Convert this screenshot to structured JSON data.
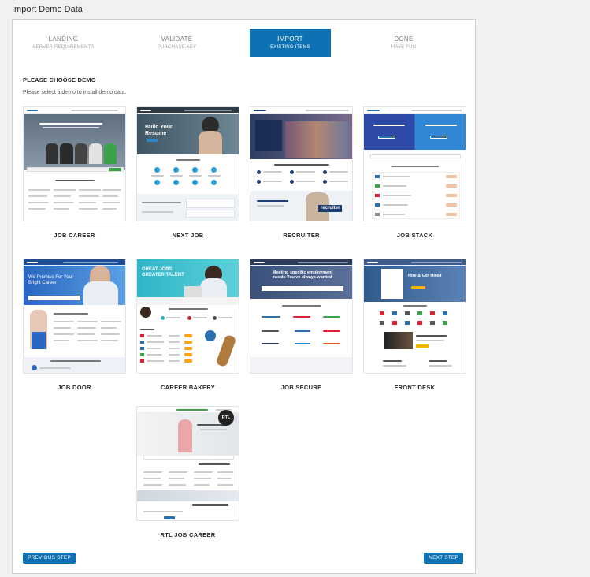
{
  "page": {
    "title": "Import Demo Data"
  },
  "steps": [
    {
      "title": "LANDING",
      "subtitle": "SERVER REQUIREMENTS",
      "active": false
    },
    {
      "title": "VALIDATE",
      "subtitle": "PURCHASE KEY",
      "active": false
    },
    {
      "title": "IMPORT",
      "subtitle": "EXISTING ITEMS",
      "active": true
    },
    {
      "title": "DONE",
      "subtitle": "HAVE FUN",
      "active": false
    }
  ],
  "section": {
    "heading": "PLEASE CHOOSE DEMO",
    "instruction": "Please select a demo to install demo data."
  },
  "thumbnail_text": {
    "next_job_hero": "Build Your Resume",
    "recruiter_logo": "recruiter",
    "job_door_hero": "We Promise For Your Bright Career",
    "career_bakery_hero": "GREAT JOBS. GREATER TALENT",
    "job_secure_hero": "Meeting specific employment needs You've always wanted",
    "front_desk_hero": "Hire & Get Hired",
    "rtl_badge": "RTL"
  },
  "demos": [
    {
      "label": "JOB CAREER"
    },
    {
      "label": "NEXT JOB"
    },
    {
      "label": "RECRUITER"
    },
    {
      "label": "JOB STACK"
    },
    {
      "label": "JOB DOOR"
    },
    {
      "label": "CAREER BAKERY"
    },
    {
      "label": "JOB SECURE"
    },
    {
      "label": "FRONT DESK"
    },
    {
      "label": "RTL JOB CAREER"
    }
  ],
  "buttons": {
    "previous": "PREVIOUS STEP",
    "next": "NEXT STEP"
  },
  "colors": {
    "accent": "#0d72b3",
    "panel_bg": "#ffffff",
    "page_bg": "#f1f1f1"
  }
}
